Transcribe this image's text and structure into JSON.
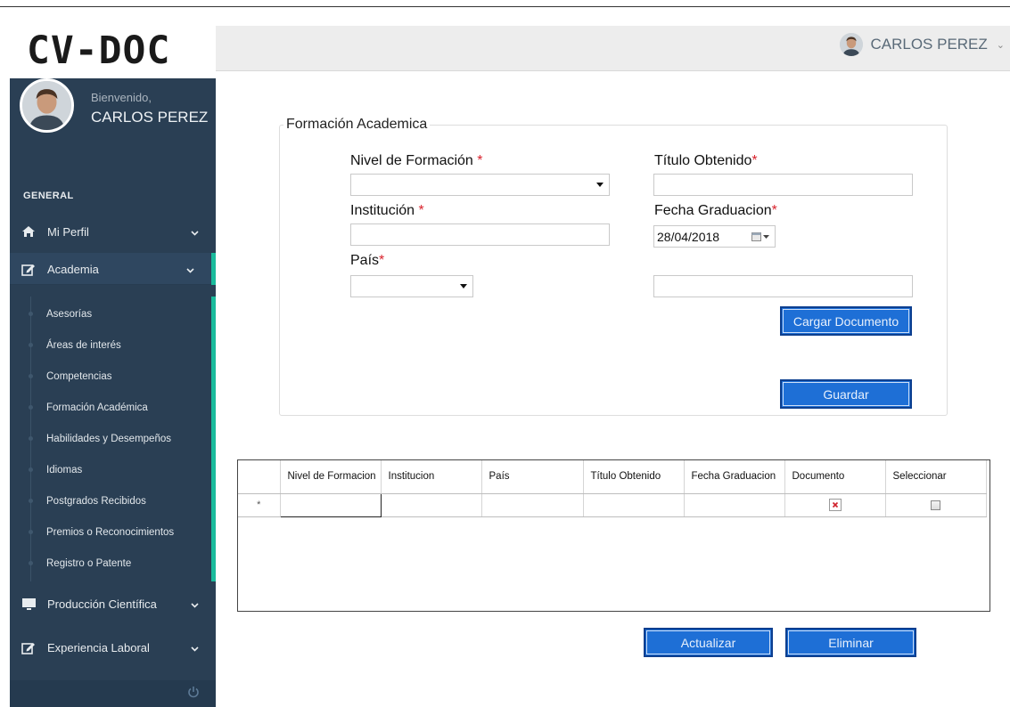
{
  "app": {
    "logo": "CV-DOC"
  },
  "topbar": {
    "user_name": "CARLOS PEREZ"
  },
  "sidebar": {
    "welcome": "Bienvenido,",
    "user_name": "CARLOS PEREZ",
    "section": "GENERAL",
    "items": [
      {
        "label": "Mi Perfil",
        "icon": "home-icon"
      },
      {
        "label": "Academia",
        "icon": "edit-icon",
        "active": true
      },
      {
        "label": "Producción Científica",
        "icon": "monitor-icon"
      },
      {
        "label": "Experiencia Laboral",
        "icon": "edit-icon"
      }
    ],
    "submenu": [
      "Asesorías",
      "Áreas de interés",
      "Competencias",
      "Formación Académica",
      "Habilidades y Desempeños",
      "Idiomas",
      "Postgrados Recibidos",
      "Premios o Reconocimientos",
      "Registro o Patente"
    ],
    "accent_color": "#1abb9c"
  },
  "form": {
    "legend": "Formación Academica",
    "nivel_label": "Nivel de Formación",
    "titulo_label": "Título Obtenido",
    "institucion_label": "Institución",
    "fecha_label": "Fecha Graduacion",
    "fecha_value": "28/04/2018",
    "pais_label": "País",
    "required_mark": "*",
    "cargar_button": "Cargar Documento",
    "guardar_button": "Guardar"
  },
  "grid": {
    "columns": [
      "Nivel de Formacion",
      "Institucion",
      "País",
      "Título Obtenido",
      "Fecha Graduacion",
      "Documento",
      "Seleccionar"
    ],
    "new_row_marker": "*"
  },
  "actions": {
    "actualizar": "Actualizar",
    "eliminar": "Eliminar"
  },
  "colors": {
    "sidebar": "#2a3f54",
    "button": "#1e6fd6",
    "required": "#d9232d"
  }
}
